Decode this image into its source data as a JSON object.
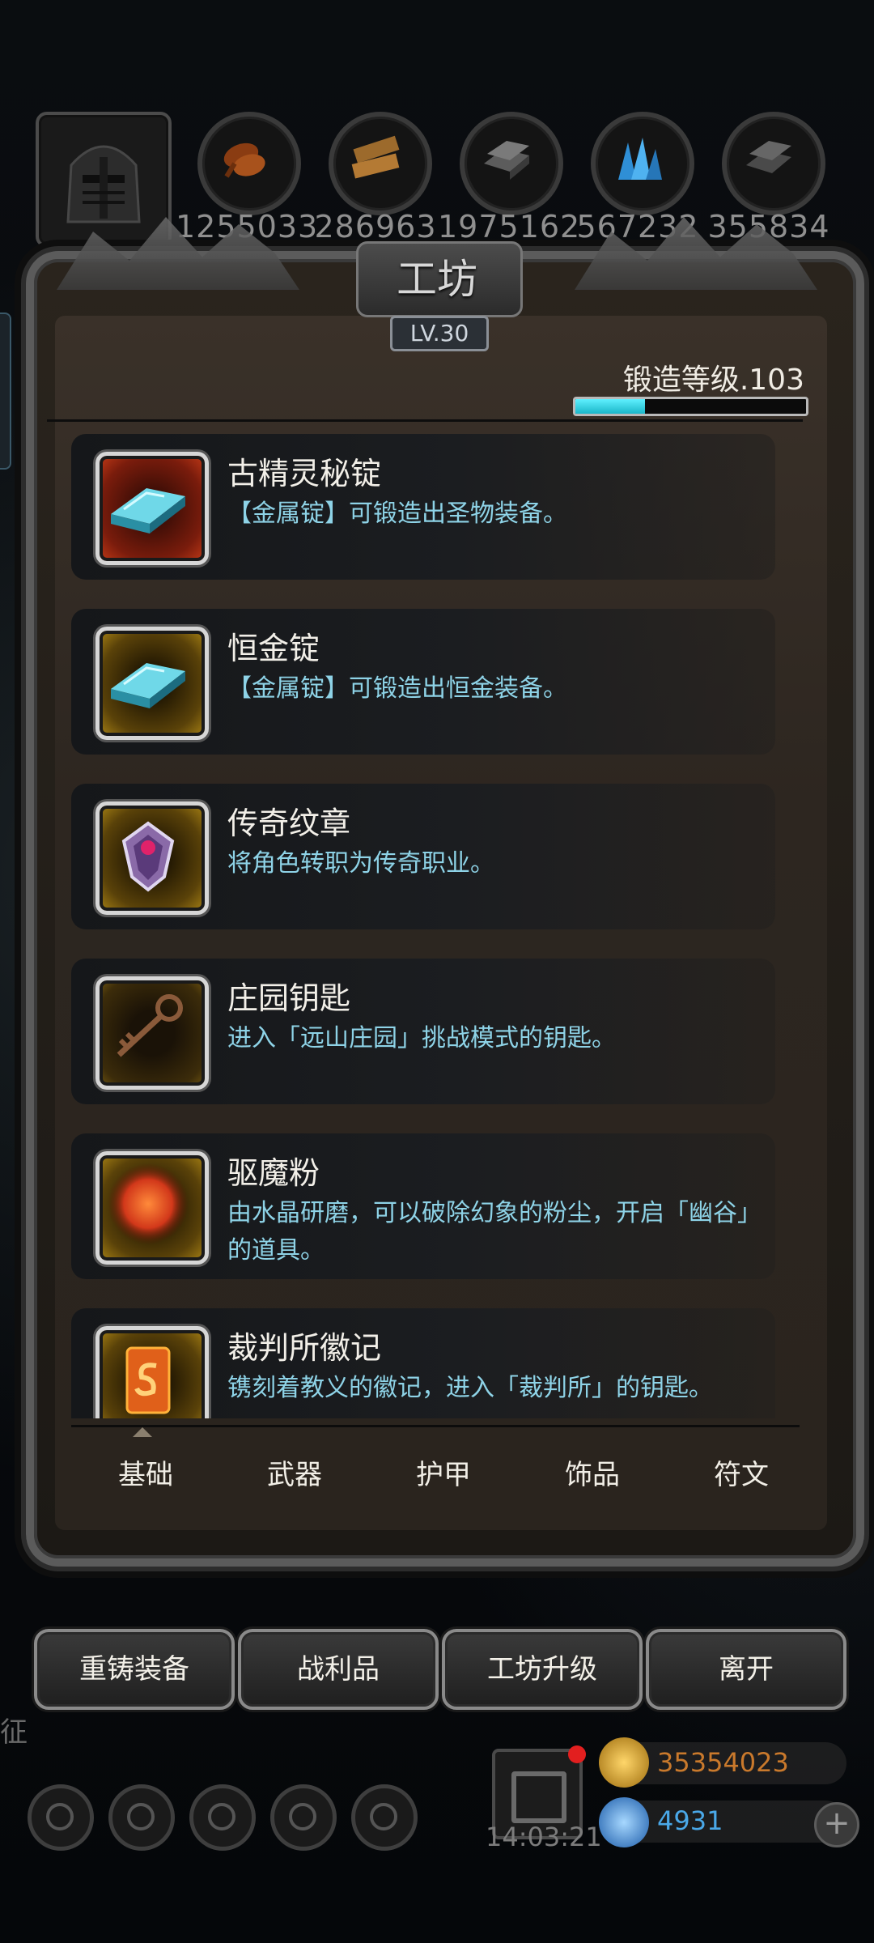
{
  "header": {
    "resources": [
      {
        "icon": "bread-icon",
        "value": "1255033"
      },
      {
        "icon": "wood-plank-icon",
        "value": "286963"
      },
      {
        "icon": "iron-ingot-icon",
        "value": "1975162"
      },
      {
        "icon": "blue-crystal-icon",
        "value": "567232"
      },
      {
        "icon": "dark-steel-icon",
        "value": "355834"
      }
    ]
  },
  "workshop": {
    "title": "工坊",
    "level": "LV.30",
    "forge_level": "锻造等级.103",
    "forge_progress": 0.3
  },
  "items": [
    {
      "name": "古精灵秘锭",
      "desc": "【金属锭】可锻造出圣物装备。",
      "icon": "blue-ingot-icon",
      "frame": "red"
    },
    {
      "name": "恒金锭",
      "desc": "【金属锭】可锻造出恒金装备。",
      "icon": "blue-ingot-icon",
      "frame": "gold"
    },
    {
      "name": "传奇纹章",
      "desc": "将角色转职为传奇职业。",
      "icon": "crest-emblem-icon",
      "frame": "gold"
    },
    {
      "name": "庄园钥匙",
      "desc": "进入「远山庄园」挑战模式的钥匙。",
      "icon": "key-icon",
      "frame": "gold"
    },
    {
      "name": "驱魔粉",
      "desc": "由水晶研磨，可以破除幻象的粉尘，开启「幽谷」的道具。",
      "icon": "red-powder-icon",
      "frame": "gold"
    },
    {
      "name": "裁判所徽记",
      "desc": "镌刻着教义的徽记，进入「裁判所」的钥匙。",
      "icon": "seal-card-icon",
      "frame": "gold"
    }
  ],
  "tabs": [
    "基础",
    "武器",
    "护甲",
    "饰品",
    "符文"
  ],
  "buttons": [
    "重铸装备",
    "战利品",
    "工坊升级",
    "离开"
  ],
  "footer": {
    "left_label": "征",
    "timer": "14:03:21",
    "gold": "35354023",
    "gems": "4931",
    "plus": "+",
    "colors": {
      "gold_text": "#c9792c",
      "gem_text": "#4aa8e8"
    }
  }
}
